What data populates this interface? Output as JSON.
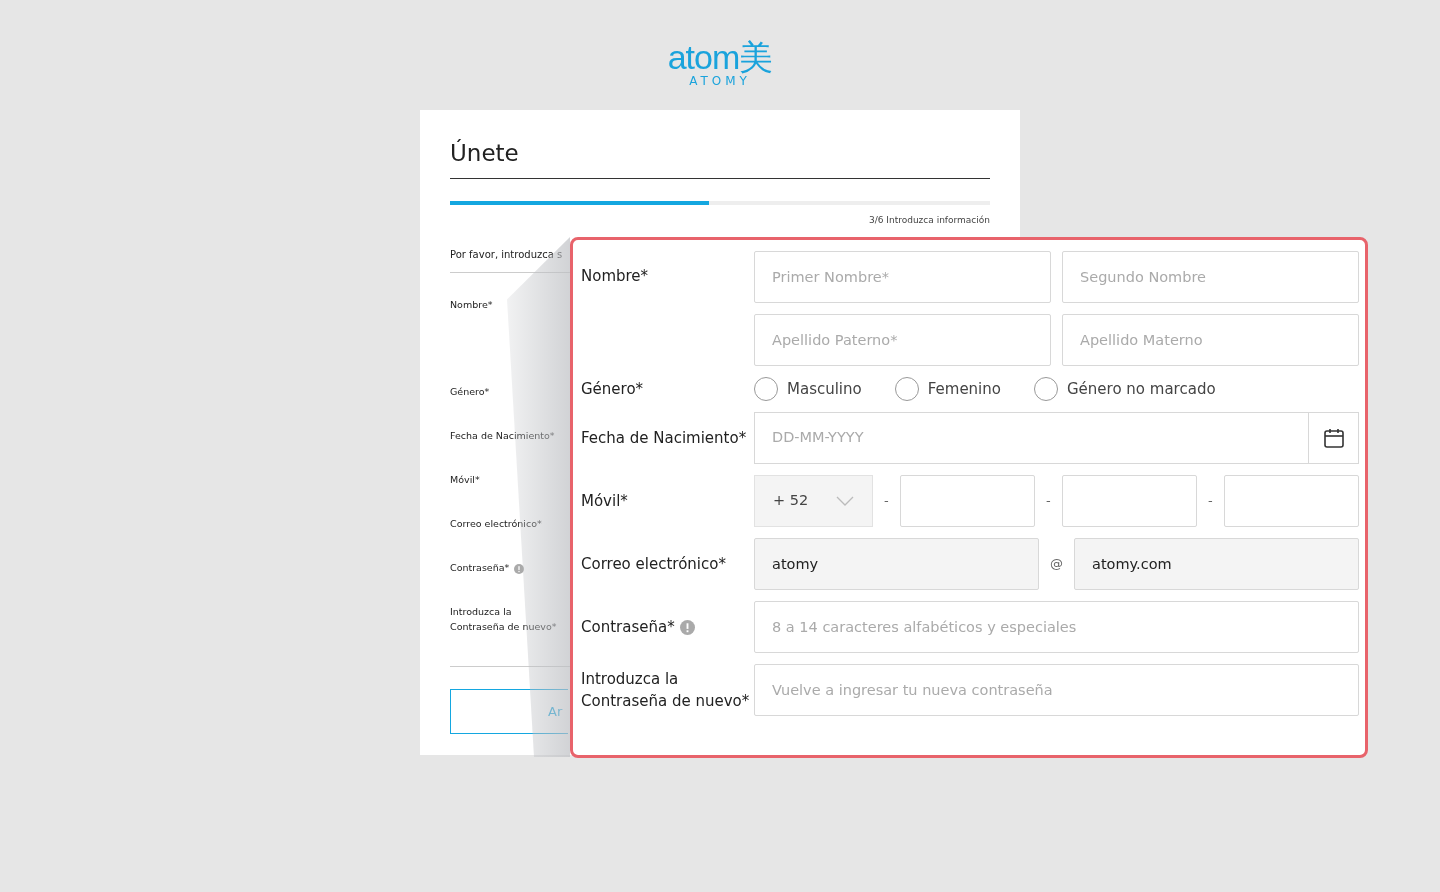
{
  "logo": {
    "wordmark": "atom美",
    "subtitle": "ATOMY"
  },
  "card": {
    "title": "Únete",
    "progress": {
      "level": 0.48,
      "caption": "3/6 Introduzca información"
    },
    "intro": "Por favor, introduzca s",
    "labels": [
      {
        "text": "Nombre*",
        "info": false,
        "kind": "tall"
      },
      {
        "text": "Género*",
        "info": false,
        "kind": "single"
      },
      {
        "text": "Fecha de Nacimiento*",
        "info": false,
        "kind": "single"
      },
      {
        "text": "Móvil*",
        "info": false,
        "kind": "single"
      },
      {
        "text": "Correo electrónico*",
        "info": false,
        "kind": "single"
      },
      {
        "text": "Contraseña*",
        "info": true,
        "kind": "single"
      },
      {
        "text": "Introduzca la Contraseña de nuevo*",
        "info": false,
        "kind": "single"
      }
    ],
    "button": "Ar"
  },
  "zoom": {
    "rows": [
      {
        "kind": "name",
        "label": "Nombre*",
        "info": false,
        "fields": [
          {
            "placeholder": "Primer Nombre*"
          },
          {
            "placeholder": "Segundo Nombre"
          },
          {
            "placeholder": "Apellido Paterno*"
          },
          {
            "placeholder": "Apellido Materno"
          }
        ]
      },
      {
        "kind": "radio",
        "label": "Género*",
        "info": false,
        "options": [
          {
            "label": "Masculino",
            "selected": false
          },
          {
            "label": "Femenino",
            "selected": false
          },
          {
            "label": "Género no marcado",
            "selected": false
          }
        ]
      },
      {
        "kind": "date",
        "label": "Fecha de Nacimiento*",
        "info": false,
        "placeholder": "DD-MM-YYYY"
      },
      {
        "kind": "phone",
        "label": "Móvil*",
        "info": false,
        "code": "+ 52",
        "separators": [
          "-",
          "-",
          "-"
        ]
      },
      {
        "kind": "email",
        "label": "Correo electrónico*",
        "info": false,
        "user": "atomy",
        "at": "@",
        "domain": "atomy.com"
      },
      {
        "kind": "password",
        "label": "Contraseña*",
        "info": true,
        "placeholder": "8 a 14 caracteres alfabéticos y especiales"
      },
      {
        "kind": "password",
        "label": "Introduzca la Contraseña de nuevo*",
        "info": false,
        "placeholder": "Vuelve a ingresar tu nueva contraseña"
      }
    ]
  }
}
